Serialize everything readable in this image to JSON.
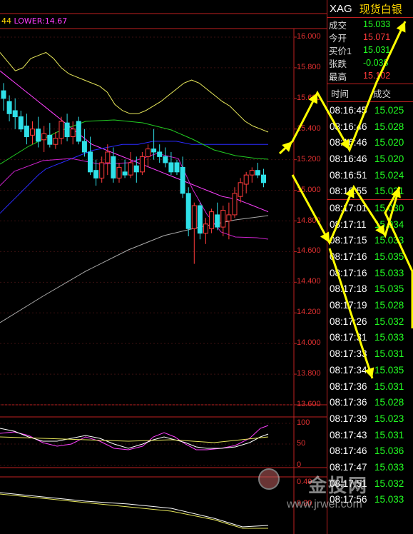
{
  "indicator_line": {
    "lead": "44",
    "text": " LOWER:14.67"
  },
  "chart_data": {
    "type": "candlestick",
    "main_axis": {
      "ticks": [
        "16.000",
        "15.800",
        "15.600",
        "15.400",
        "15.200",
        "15.000",
        "14.800",
        "14.600",
        "14.400",
        "14.200",
        "14.000",
        "13.800",
        "13.600"
      ],
      "ylim": [
        13.6,
        16.1
      ]
    },
    "osc1_axis": {
      "ticks": [
        "100",
        "50",
        "0"
      ]
    },
    "osc2_axis": {
      "ticks": [
        "0.40",
        "0.20"
      ]
    },
    "candles": [
      {
        "o": 15.65,
        "h": 15.7,
        "l": 15.52,
        "c": 15.6
      },
      {
        "o": 15.58,
        "h": 15.62,
        "l": 15.45,
        "c": 15.5
      },
      {
        "o": 15.52,
        "h": 15.6,
        "l": 15.4,
        "c": 15.48
      },
      {
        "o": 15.48,
        "h": 15.52,
        "l": 15.38,
        "c": 15.4
      },
      {
        "o": 15.42,
        "h": 15.5,
        "l": 15.3,
        "c": 15.35
      },
      {
        "o": 15.36,
        "h": 15.45,
        "l": 15.3,
        "c": 15.4
      },
      {
        "o": 15.4,
        "h": 15.48,
        "l": 15.28,
        "c": 15.32
      },
      {
        "o": 15.33,
        "h": 15.42,
        "l": 15.25,
        "c": 15.37
      },
      {
        "o": 15.36,
        "h": 15.44,
        "l": 15.28,
        "c": 15.3
      },
      {
        "o": 15.3,
        "h": 15.38,
        "l": 15.27,
        "c": 15.34
      },
      {
        "o": 15.34,
        "h": 15.48,
        "l": 15.3,
        "c": 15.45
      },
      {
        "o": 15.44,
        "h": 15.5,
        "l": 15.32,
        "c": 15.35
      },
      {
        "o": 15.35,
        "h": 15.45,
        "l": 15.3,
        "c": 15.4
      },
      {
        "o": 15.45,
        "h": 15.48,
        "l": 15.3,
        "c": 15.32
      },
      {
        "o": 15.32,
        "h": 15.4,
        "l": 15.22,
        "c": 15.25
      },
      {
        "o": 15.25,
        "h": 15.35,
        "l": 15.1,
        "c": 15.12
      },
      {
        "o": 15.13,
        "h": 15.2,
        "l": 15.03,
        "c": 15.08
      },
      {
        "o": 15.08,
        "h": 15.22,
        "l": 15.05,
        "c": 15.18
      },
      {
        "o": 15.18,
        "h": 15.3,
        "l": 15.1,
        "c": 15.25
      },
      {
        "o": 15.22,
        "h": 15.28,
        "l": 15.05,
        "c": 15.08
      },
      {
        "o": 15.08,
        "h": 15.18,
        "l": 15.05,
        "c": 15.15
      },
      {
        "o": 15.12,
        "h": 15.2,
        "l": 15.08,
        "c": 15.1
      },
      {
        "o": 15.1,
        "h": 15.25,
        "l": 15.08,
        "c": 15.18
      },
      {
        "o": 15.16,
        "h": 15.22,
        "l": 15.05,
        "c": 15.12
      },
      {
        "o": 15.12,
        "h": 15.25,
        "l": 15.1,
        "c": 15.22
      },
      {
        "o": 15.22,
        "h": 15.3,
        "l": 15.15,
        "c": 15.27
      },
      {
        "o": 15.27,
        "h": 15.4,
        "l": 15.2,
        "c": 15.25
      },
      {
        "o": 15.25,
        "h": 15.3,
        "l": 15.18,
        "c": 15.22
      },
      {
        "o": 15.22,
        "h": 15.28,
        "l": 15.15,
        "c": 15.18
      },
      {
        "o": 15.18,
        "h": 15.25,
        "l": 15.1,
        "c": 15.12
      },
      {
        "o": 15.18,
        "h": 15.2,
        "l": 15.1,
        "c": 15.12
      },
      {
        "o": 15.15,
        "h": 15.22,
        "l": 14.95,
        "c": 14.98
      },
      {
        "o": 14.98,
        "h": 15.02,
        "l": 14.7,
        "c": 14.75
      },
      {
        "o": 14.75,
        "h": 14.92,
        "l": 14.52,
        "c": 14.9
      },
      {
        "o": 14.9,
        "h": 14.92,
        "l": 14.68,
        "c": 14.72
      },
      {
        "o": 14.72,
        "h": 14.82,
        "l": 14.65,
        "c": 14.78
      },
      {
        "o": 14.75,
        "h": 14.88,
        "l": 14.72,
        "c": 14.86
      },
      {
        "o": 14.84,
        "h": 14.92,
        "l": 14.74,
        "c": 14.76
      },
      {
        "o": 14.76,
        "h": 14.9,
        "l": 14.7,
        "c": 14.87
      },
      {
        "o": 14.8,
        "h": 14.92,
        "l": 14.68,
        "c": 14.84
      },
      {
        "o": 14.84,
        "h": 15.02,
        "l": 14.82,
        "c": 14.98
      },
      {
        "o": 14.96,
        "h": 15.08,
        "l": 14.92,
        "c": 15.05
      },
      {
        "o": 15.04,
        "h": 15.12,
        "l": 14.98,
        "c": 15.1
      },
      {
        "o": 15.1,
        "h": 15.15,
        "l": 15.05,
        "c": 15.13
      },
      {
        "o": 15.13,
        "h": 15.18,
        "l": 15.08,
        "c": 15.1
      },
      {
        "o": 15.1,
        "h": 15.14,
        "l": 15.02,
        "c": 15.05
      }
    ],
    "lines": [
      {
        "color": "#e8e85a",
        "values": [
          15.9,
          15.84,
          15.78,
          15.8,
          15.86,
          15.88,
          15.9,
          15.86,
          15.8,
          15.76,
          15.74,
          15.72,
          15.7,
          15.68,
          15.64,
          15.56,
          15.52,
          15.5,
          15.5,
          15.52,
          15.55,
          15.58,
          15.62,
          15.66,
          15.7,
          15.72,
          15.7,
          15.66,
          15.62,
          15.58,
          15.55,
          15.5,
          15.45,
          15.42,
          15.4,
          15.38
        ]
      },
      {
        "color": "#ff40ff",
        "values": [
          15.78,
          15.74,
          15.7,
          15.66,
          15.62,
          15.58,
          15.54,
          15.5,
          15.46,
          15.42,
          15.38,
          15.34,
          15.3,
          15.28,
          15.26,
          15.24,
          15.22,
          15.2,
          15.18,
          15.16,
          15.14,
          15.12,
          15.1,
          15.08,
          15.06,
          15.04,
          15.02,
          15.0,
          14.98,
          14.96,
          14.95,
          14.94,
          14.92,
          14.9,
          14.88,
          14.86
        ]
      },
      {
        "color": "#2a2aff",
        "values": [
          14.85,
          14.9,
          14.95,
          15.0,
          15.05,
          15.1,
          15.14,
          15.16,
          15.18,
          15.2,
          15.22,
          15.24,
          15.26,
          15.27,
          15.28,
          15.29,
          15.3,
          15.3,
          15.3,
          15.31,
          15.32,
          15.32,
          15.32,
          15.32,
          15.31,
          15.3,
          15.3,
          15.3,
          15.3,
          15.3,
          15.3,
          15.3,
          15.3,
          15.3,
          15.3,
          15.3
        ]
      }
    ]
  },
  "panel": {
    "symbol": "XAG",
    "name": "现货白银",
    "quote": [
      {
        "label": "成交",
        "value": "15.033",
        "color": "green"
      },
      {
        "label": "今开",
        "value": "15.071",
        "color": "red"
      },
      {
        "label": "买价1",
        "value": "15.031",
        "color": "green"
      },
      {
        "label": "张跌",
        "value": "-0.038",
        "color": "green"
      },
      {
        "label": "最高",
        "value": "15.102",
        "color": "red"
      }
    ],
    "trades_header": {
      "time": "时间",
      "price": "成交"
    },
    "trades_group1": [
      {
        "time": "08:16:45",
        "price": "15.025"
      },
      {
        "time": "08:16:46",
        "price": "15.028"
      },
      {
        "time": "08:16:46",
        "price": "15.020"
      },
      {
        "time": "08:16:46",
        "price": "15.020"
      },
      {
        "time": "08:16:51",
        "price": "15.024"
      },
      {
        "time": "08:16:55",
        "price": "15.021"
      }
    ],
    "trades_group2": [
      {
        "time": "08:17:01",
        "price": "15.030"
      },
      {
        "time": "08:17:11",
        "price": "15.034"
      },
      {
        "time": "08:17:15",
        "price": "15.033"
      },
      {
        "time": "08:17:16",
        "price": "15.035"
      },
      {
        "time": "08:17:16",
        "price": "15.033"
      },
      {
        "time": "08:17:18",
        "price": "15.035"
      },
      {
        "time": "08:17:19",
        "price": "15.028"
      },
      {
        "time": "08:17:26",
        "price": "15.032"
      },
      {
        "time": "08:17:31",
        "price": "15.033"
      },
      {
        "time": "08:17:33",
        "price": "15.031"
      },
      {
        "time": "08:17:34",
        "price": "15.035"
      },
      {
        "time": "08:17:36",
        "price": "15.031"
      },
      {
        "time": "08:17:36",
        "price": "15.028"
      },
      {
        "time": "08:17:39",
        "price": "15.023"
      },
      {
        "time": "08:17:43",
        "price": "15.031"
      },
      {
        "time": "08:17:46",
        "price": "15.036"
      },
      {
        "time": "08:17:47",
        "price": "15.033"
      },
      {
        "time": "08:17:51",
        "price": "15.032"
      },
      {
        "time": "08:17:56",
        "price": "15.033"
      }
    ]
  },
  "watermark": {
    "title": "金投网",
    "url": "www.jrwei.com"
  }
}
